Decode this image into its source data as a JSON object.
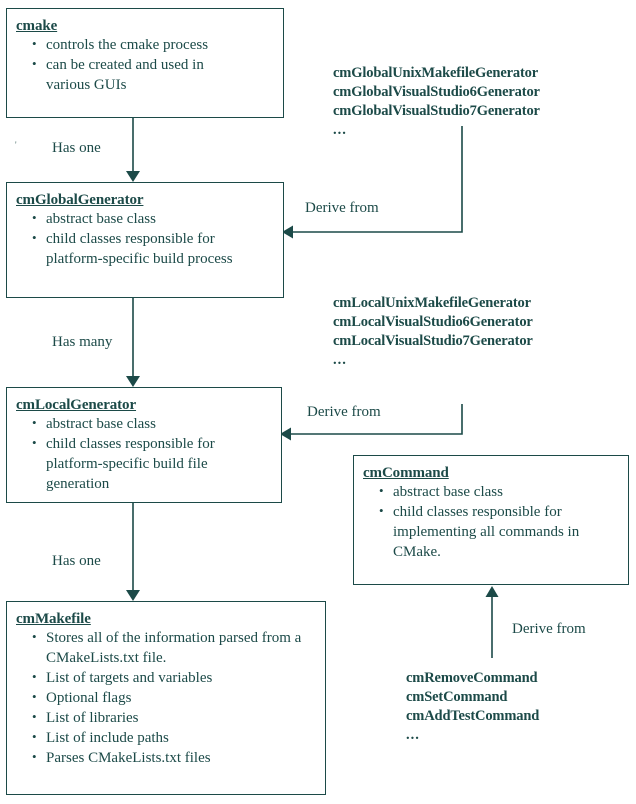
{
  "diagram": {
    "title": "CMake class architecture diagram",
    "colors": {
      "stroke": "#1c4a48",
      "text": "#1c4a48",
      "background": "#ffffff"
    },
    "boxes": [
      {
        "id": "cmake",
        "title": "cmake",
        "bullets": [
          "controls the cmake process",
          "can be created and used in various GUIs"
        ]
      },
      {
        "id": "cmGlobalGenerator",
        "title": "cmGlobalGenerator",
        "bullets": [
          "abstract base class",
          "child classes responsible for platform-specific build process"
        ]
      },
      {
        "id": "cmLocalGenerator",
        "title": "cmLocalGenerator",
        "bullets": [
          "abstract base class",
          "child classes responsible for platform-specific build file generation"
        ]
      },
      {
        "id": "cmMakefile",
        "title": "cmMakefile",
        "bullets": [
          "Stores all of the information parsed from a CMakeLists.txt file.",
          "List of targets and variables",
          "Optional flags",
          "List of libraries",
          "List of include paths",
          "Parses CMakeLists.txt files"
        ]
      },
      {
        "id": "cmCommand",
        "title": "cmCommand",
        "bullets": [
          "abstract base class",
          "child classes responsible for implementing all commands in CMake."
        ]
      }
    ],
    "edge_labels": {
      "has_one_1": "Has one",
      "has_many": "Has many",
      "has_one_2": "Has one",
      "derive_from_global": "Derive from",
      "derive_from_local": "Derive from",
      "derive_from_command": "Derive from"
    },
    "subclass_lists": {
      "global_generators": {
        "items": [
          "cmGlobalUnixMakefileGenerator",
          "cmGlobalVisualStudio6Generator",
          "cmGlobalVisualStudio7Generator"
        ],
        "ellipsis": "..."
      },
      "local_generators": {
        "items": [
          "cmLocalUnixMakefileGenerator",
          "cmLocalVisualStudio6Generator",
          "cmLocalVisualStudio7Generator"
        ],
        "ellipsis": "..."
      },
      "commands": {
        "items": [
          "cmRemoveCommand",
          "cmSetCommand",
          "cmAddTestCommand"
        ],
        "ellipsis": "..."
      }
    },
    "stray_mark": "'"
  }
}
